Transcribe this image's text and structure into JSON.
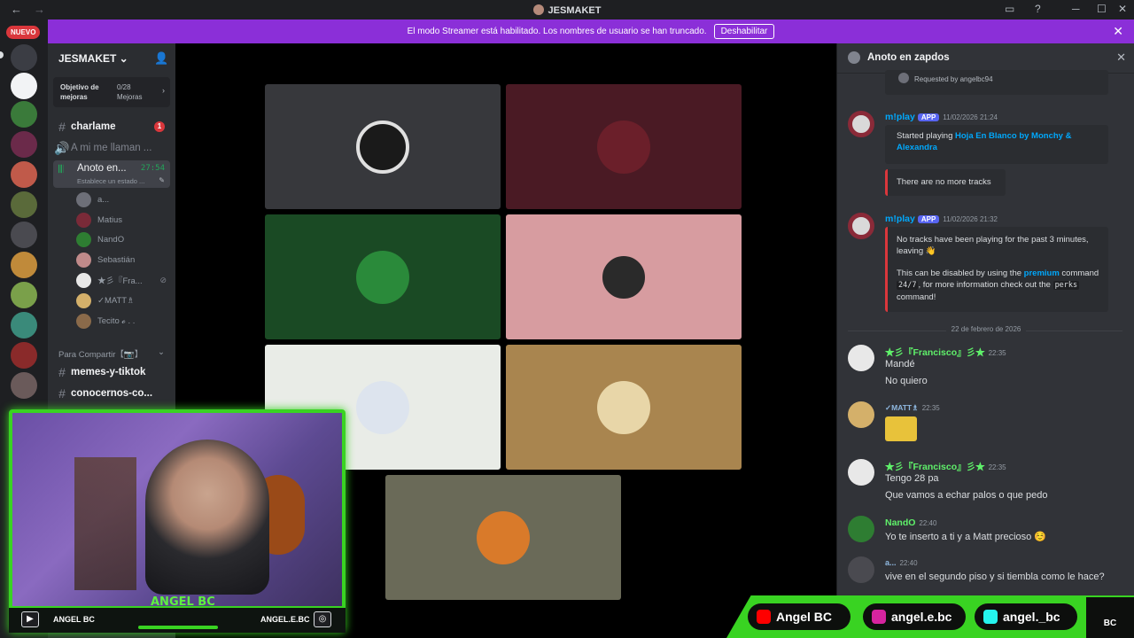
{
  "window": {
    "title": "JESMAKET"
  },
  "banner": {
    "text": "El modo Streamer está habilitado. Los nombres de usuario se han truncado.",
    "button": "Deshabilitar"
  },
  "rail": {
    "new_badge": "NUEVO",
    "notification_count": "1"
  },
  "sidebar": {
    "server_name": "JESMAKET ⌄",
    "goal_label": "Objetivo de mejoras",
    "goal_value": "0/28 Mejoras",
    "channels": [
      {
        "name": "charlame",
        "badge": "1"
      },
      {
        "name": "A mi me llaman ..."
      }
    ],
    "voice": {
      "name": "Anoto en...",
      "time": "27:54",
      "status": "Establece un estado ..."
    },
    "voice_users": [
      "a...",
      "Matius",
      "NandO",
      "Sebastián",
      "★彡『Fra...",
      "✓MATT♗",
      "Tecito 𝓸 . ."
    ],
    "category": "Para Compartir【📷】",
    "channels2": [
      "memes-y-tiktok",
      "conocernos-co..."
    ]
  },
  "chat": {
    "title": "Anoto en zapdos",
    "requested": "Requested by angelbc94",
    "msgs": {
      "bot1": {
        "user": "m!play",
        "app": "APP",
        "time": "11/02/2026 21:24",
        "started": "Started playing",
        "track": "Hoja En Blanco by Monchy & Alexandra",
        "notracks": "There are no more tracks"
      },
      "bot2": {
        "user": "m!play",
        "app": "APP",
        "time": "11/02/2026 21:32",
        "l1": "No tracks have been playing for the past 3 minutes, leaving 👋",
        "l2a": "This can be disabled by using the",
        "l2link": "premium",
        "l2b": "command",
        "code1": "24/7",
        "l2c": ", for more information check out the",
        "code2": "perks",
        "l2d": "command!"
      },
      "date_divider": "22 de febrero de 2026",
      "fran1": {
        "user": "★彡『Francisco』彡★",
        "time": "22:35",
        "l1": "Mandé",
        "l2": "No quiero"
      },
      "matt": {
        "user": "✓MATT♗",
        "time": "22:35"
      },
      "fran2": {
        "user": "★彡『Francisco』彡★",
        "time": "22:35",
        "l1": "Tengo 28 pa",
        "l2": "Que vamos a echar palos o que pedo"
      },
      "nando": {
        "user": "NandO",
        "time": "22:40",
        "l1": "Yo te inserto a ti y a Matt precioso ☺️"
      },
      "a": {
        "user": "a...",
        "time": "22:40",
        "l1": "vive en el segundo piso y si tiembla como le hace?"
      }
    }
  },
  "overlay": {
    "name": "ANGEL BC",
    "yt_label": "ANGEL BC",
    "ig_label": "ANGEL.E.BC",
    "social": [
      "Angel BC",
      "angel.e.bc",
      "angel._bc"
    ],
    "logo": "BC"
  },
  "colors": {
    "accent": "#8b2fd8",
    "green": "#39d322",
    "link": "#00a8fc"
  }
}
